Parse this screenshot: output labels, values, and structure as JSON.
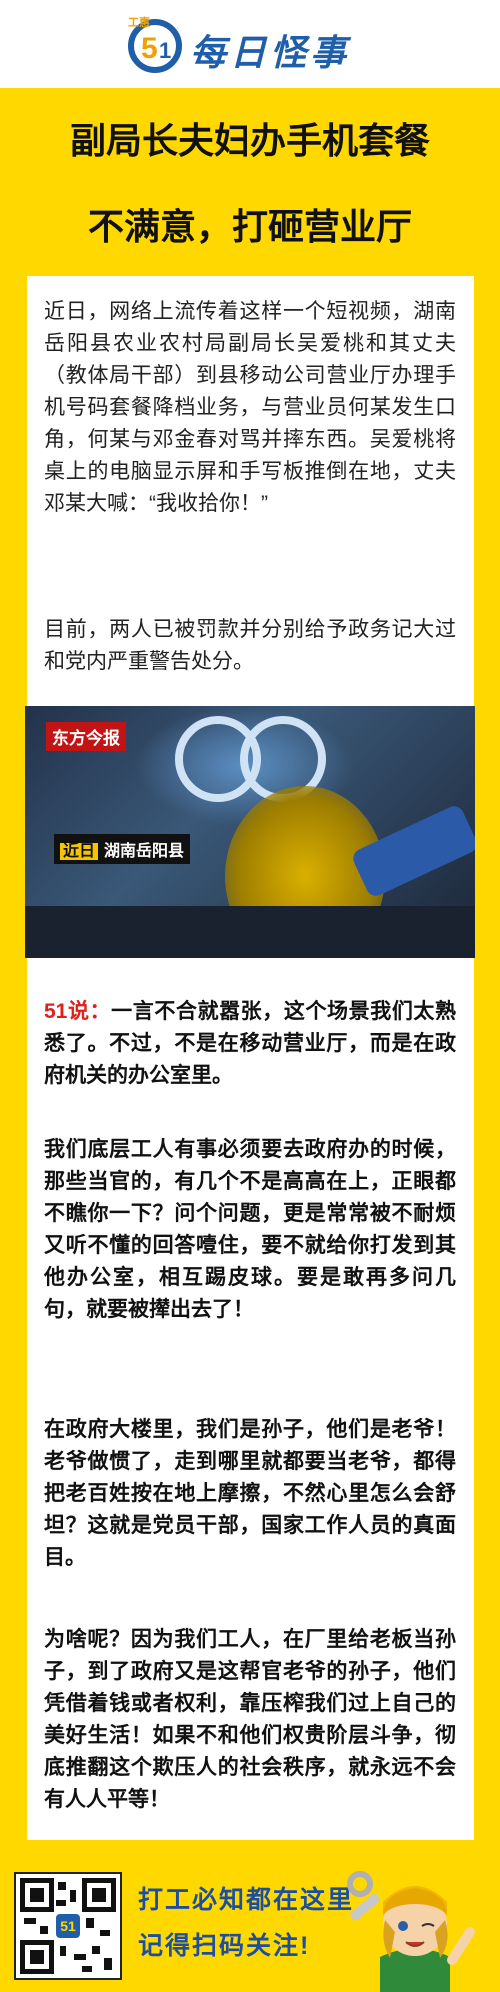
{
  "header": {
    "brand_small": "工惠",
    "brand_mark": "51",
    "brand_name": "每日怪事"
  },
  "headline": {
    "line1": "副局长夫妇办手机套餐",
    "line2": "不满意，打砸营业厅"
  },
  "article": {
    "p1": "近日，网络上流传着这样一个短视频，湖南岳阳县农业农村局副局长吴爱桃和其丈夫（教体局干部）到县移动公司营业厅办理手机号码套餐降档业务，与营业员何某发生口角，何某与邓金春对骂并摔东西。吴爱桃将桌上的电脑显示屏和手写板推倒在地，丈夫邓某大喊：“我收拾你！”",
    "p2": "目前，两人已被罚款并分别给予政务记大过和党内严重警告处分。"
  },
  "video": {
    "badge": "东方今报",
    "loc_tag": "近日",
    "loc_text": "湖南岳阳县"
  },
  "commentary": {
    "prefix": "51说：",
    "p3": "一言不合就嚣张，这个场景我们太熟悉了。不过，不是在移动营业厅，而是在政府机关的办公室里。",
    "p4": "我们底层工人有事必须要去政府办的时候，那些当官的，有几个不是高高在上，正眼都不瞧你一下？问个问题，更是常常被不耐烦又听不懂的回答噎住，要不就给你打发到其他办公室，相互踢皮球。要是敢再多问几句，就要被撵出去了！",
    "p5": "在政府大楼里，我们是孙子，他们是老爷！老爷做惯了，走到哪里就都要当老爷，都得把老百姓按在地上摩擦，不然心里怎么会舒坦？这就是党员干部，国家工作人员的真面目。",
    "p6": "为啥呢？因为我们工人，在厂里给老板当孙子，到了政府又是这帮官老爷的孙子，他们凭借着钱或者权利，靠压榨我们过上自己的美好生活！如果不和他们权贵阶层斗争，彻底推翻这个欺压人的社会秩序，就永远不会有人人平等！"
  },
  "footer": {
    "slogan1": "打工必知都在这里",
    "slogan2": "记得扫码关注!",
    "qr_center": "51"
  },
  "colors": {
    "background": "#ffd800",
    "accent_red": "#e0201a",
    "brand_blue": "#1d4fa0"
  }
}
